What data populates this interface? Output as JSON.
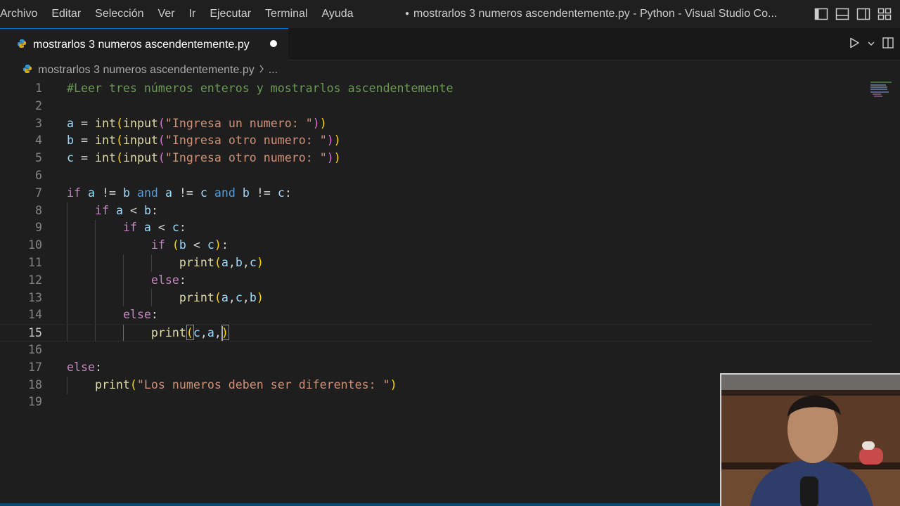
{
  "menu": [
    "Archivo",
    "Editar",
    "Selección",
    "Ver",
    "Ir",
    "Ejecutar",
    "Terminal",
    "Ayuda"
  ],
  "window_title": "mostrarlos 3 numeros ascendentemente.py - Python - Visual Studio Co...",
  "tab": {
    "label": "mostrarlos 3 numeros ascendentemente.py",
    "dirty": true
  },
  "breadcrumb": {
    "file": "mostrarlos 3 numeros ascendentemente.py",
    "ellipsis": "..."
  },
  "editor": {
    "current_line": 15,
    "line_numbers": [
      "1",
      "2",
      "3",
      "4",
      "5",
      "6",
      "7",
      "8",
      "9",
      "10",
      "11",
      "12",
      "13",
      "14",
      "15",
      "16",
      "17",
      "18",
      "19"
    ],
    "lines": [
      [
        [
          "c-comment",
          "#Leer tres números enteros y mostrarlos ascendentemente"
        ]
      ],
      [],
      [
        [
          "c-var",
          "a"
        ],
        [
          "c-op",
          " = "
        ],
        [
          "c-func",
          "int"
        ],
        [
          "c-p1",
          "("
        ],
        [
          "c-func",
          "input"
        ],
        [
          "c-p2",
          "("
        ],
        [
          "c-str",
          "\"Ingresa un numero: \""
        ],
        [
          "c-p2",
          ")"
        ],
        [
          "c-p1",
          ")"
        ]
      ],
      [
        [
          "c-var",
          "b"
        ],
        [
          "c-op",
          " = "
        ],
        [
          "c-func",
          "int"
        ],
        [
          "c-p1",
          "("
        ],
        [
          "c-func",
          "input"
        ],
        [
          "c-p2",
          "("
        ],
        [
          "c-str",
          "\"Ingresa otro numero: \""
        ],
        [
          "c-p2",
          ")"
        ],
        [
          "c-p1",
          ")"
        ]
      ],
      [
        [
          "c-var",
          "c"
        ],
        [
          "c-op",
          " = "
        ],
        [
          "c-func",
          "int"
        ],
        [
          "c-p1",
          "("
        ],
        [
          "c-func",
          "input"
        ],
        [
          "c-p2",
          "("
        ],
        [
          "c-str",
          "\"Ingresa otro numero: \""
        ],
        [
          "c-p2",
          ")"
        ],
        [
          "c-p1",
          ")"
        ]
      ],
      [],
      [
        [
          "c-kw",
          "if"
        ],
        [
          "c-op",
          " "
        ],
        [
          "c-var",
          "a"
        ],
        [
          "c-op",
          " != "
        ],
        [
          "c-var",
          "b"
        ],
        [
          "c-op",
          " "
        ],
        [
          "c-and",
          "and"
        ],
        [
          "c-op",
          " "
        ],
        [
          "c-var",
          "a"
        ],
        [
          "c-op",
          " != "
        ],
        [
          "c-var",
          "c"
        ],
        [
          "c-op",
          " "
        ],
        [
          "c-and",
          "and"
        ],
        [
          "c-op",
          " "
        ],
        [
          "c-var",
          "b"
        ],
        [
          "c-op",
          " != "
        ],
        [
          "c-var",
          "c"
        ],
        [
          "c-op",
          ":"
        ]
      ],
      [
        [
          "c-op",
          "    "
        ],
        [
          "c-kw",
          "if"
        ],
        [
          "c-op",
          " "
        ],
        [
          "c-var",
          "a"
        ],
        [
          "c-op",
          " < "
        ],
        [
          "c-var",
          "b"
        ],
        [
          "c-op",
          ":"
        ]
      ],
      [
        [
          "c-op",
          "        "
        ],
        [
          "c-kw",
          "if"
        ],
        [
          "c-op",
          " "
        ],
        [
          "c-var",
          "a"
        ],
        [
          "c-op",
          " < "
        ],
        [
          "c-var",
          "c"
        ],
        [
          "c-op",
          ":"
        ]
      ],
      [
        [
          "c-op",
          "            "
        ],
        [
          "c-kw",
          "if"
        ],
        [
          "c-op",
          " "
        ],
        [
          "c-p1",
          "("
        ],
        [
          "c-var",
          "b"
        ],
        [
          "c-op",
          " < "
        ],
        [
          "c-var",
          "c"
        ],
        [
          "c-p1",
          ")"
        ],
        [
          "c-op",
          ":"
        ]
      ],
      [
        [
          "c-op",
          "                "
        ],
        [
          "c-func",
          "print"
        ],
        [
          "c-p1",
          "("
        ],
        [
          "c-var",
          "a"
        ],
        [
          "c-op",
          ","
        ],
        [
          "c-var",
          "b"
        ],
        [
          "c-op",
          ","
        ],
        [
          "c-var",
          "c"
        ],
        [
          "c-p1",
          ")"
        ]
      ],
      [
        [
          "c-op",
          "            "
        ],
        [
          "c-kw",
          "else"
        ],
        [
          "c-op",
          ":"
        ]
      ],
      [
        [
          "c-op",
          "                "
        ],
        [
          "c-func",
          "print"
        ],
        [
          "c-p1",
          "("
        ],
        [
          "c-var",
          "a"
        ],
        [
          "c-op",
          ","
        ],
        [
          "c-var",
          "c"
        ],
        [
          "c-op",
          ","
        ],
        [
          "c-var",
          "b"
        ],
        [
          "c-p1",
          ")"
        ]
      ],
      [
        [
          "c-op",
          "        "
        ],
        [
          "c-kw",
          "else"
        ],
        [
          "c-op",
          ":"
        ]
      ],
      [
        [
          "c-op",
          "            "
        ],
        [
          "c-func",
          "print"
        ],
        [
          "c-p1",
          "("
        ],
        [
          "c-var",
          "c"
        ],
        [
          "c-op",
          ","
        ],
        [
          "c-var",
          "a"
        ],
        [
          "c-op",
          ","
        ],
        [
          "c-p1",
          ")"
        ]
      ],
      [],
      [
        [
          "c-kw",
          "else"
        ],
        [
          "c-op",
          ":"
        ]
      ],
      [
        [
          "c-op",
          "    "
        ],
        [
          "c-func",
          "print"
        ],
        [
          "c-p1",
          "("
        ],
        [
          "c-str",
          "\"Los numeros deben ser diferentes: \""
        ],
        [
          "c-p1",
          ")"
        ]
      ],
      []
    ]
  },
  "colors": {
    "accent": "#0078d4",
    "editor_bg": "#1e1e1e",
    "titlebar_bg": "#1f1f1f"
  },
  "icons": [
    "python-file-icon",
    "run-icon",
    "chevron-down-icon",
    "split-editor-icon",
    "layout-icons"
  ]
}
